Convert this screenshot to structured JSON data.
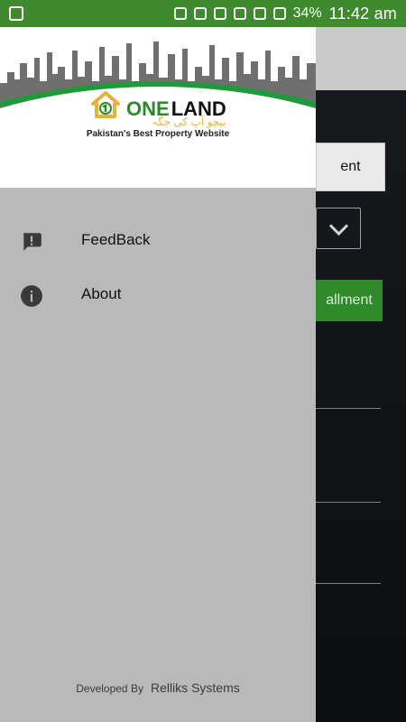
{
  "statusbar": {
    "battery": "34%",
    "time": "11:42 am",
    "icons": [
      "image-icon",
      "download-icon",
      "mute-icon",
      "alarm-icon",
      "wifi-icon",
      "one-icon",
      "signal-icon",
      "signal-icon-2",
      "battery-icon"
    ]
  },
  "drawer": {
    "brand": {
      "one": "ONE",
      "land": "LAND",
      "urdu": "بیچو آپ کی جگہ",
      "tagline": "Pakistan's Best Property Website"
    },
    "menu": [
      {
        "label": "FeedBack",
        "icon": "feedback-icon"
      },
      {
        "label": "About",
        "icon": "info-icon"
      }
    ],
    "footer": {
      "developed_by": "Developed By",
      "developer": "Relliks Systems"
    }
  },
  "background_app": {
    "tab_partial": "ent",
    "green_button_partial": "allment"
  },
  "colors": {
    "statusbar": "#3f8a2e",
    "drawer": "#b9b9b9",
    "accent_green": "#2a8a2a",
    "logo_yellow": "#e6b23a"
  }
}
